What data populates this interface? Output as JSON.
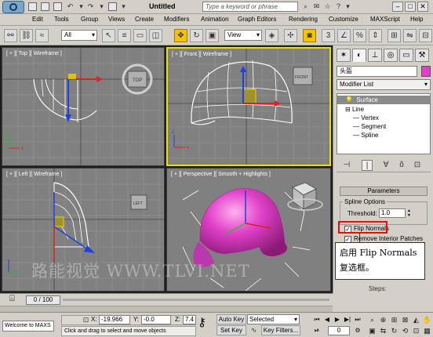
{
  "titlebar": {
    "document": "Untitled",
    "search_placeholder": "Type a keyword or phrase"
  },
  "menu": [
    "Edit",
    "Tools",
    "Group",
    "Views",
    "Create",
    "Modifiers",
    "Animation",
    "Graph Editors",
    "Rendering",
    "Customize",
    "MAXScript",
    "Help"
  ],
  "toolbar": {
    "filter_dropdown": "All",
    "coord_dropdown": "View"
  },
  "viewports": [
    {
      "label": "[ + ][ Top ][ Wireframe ]"
    },
    {
      "label": "[ + ][ Front ][ Wireframe ]"
    },
    {
      "label": "[ + ][ Left ][ Wireframe ]"
    },
    {
      "label": "[ + ][ Perspective ][ Smooth + Highlights ]"
    }
  ],
  "viewcube_labels": {
    "top": "TOP",
    "front": "FRONT",
    "left": "LEFT"
  },
  "command_panel": {
    "object_name": "头盔",
    "object_color": "#e040c8",
    "modifier_list": "Modifier List",
    "stack": {
      "surface": "Surface",
      "line": "Line",
      "vertex": "Vertex",
      "segment": "Segment",
      "spline": "Spline"
    },
    "rollout_title": "Parameters",
    "spline_options": "Spline Options",
    "threshold_label": "Threshold:",
    "threshold_value": "1.0",
    "flip_normals": "Flip Normals",
    "remove_interior": "Remove Interior Patches",
    "steps_label": "Steps:"
  },
  "callout": {
    "line1": "启用 Flip Normals",
    "line2": "复选框。"
  },
  "watermark": "路能视觉 WWW.TLVI.NET",
  "timeline": {
    "frame_range": "0 / 100"
  },
  "status": {
    "maxscript": "Welcome to MAXS",
    "prompt": "Click and drag to select and move objects",
    "x_label": "X:",
    "x_value": "-19.966",
    "y_label": "Y:",
    "y_value": "-0.0",
    "z_label": "Z:",
    "z_value": "7.4",
    "autokey": "Auto Key",
    "setkey": "Set Key",
    "selected": "Selected",
    "keyfilters": "Key Filters...",
    "frame": "0"
  }
}
